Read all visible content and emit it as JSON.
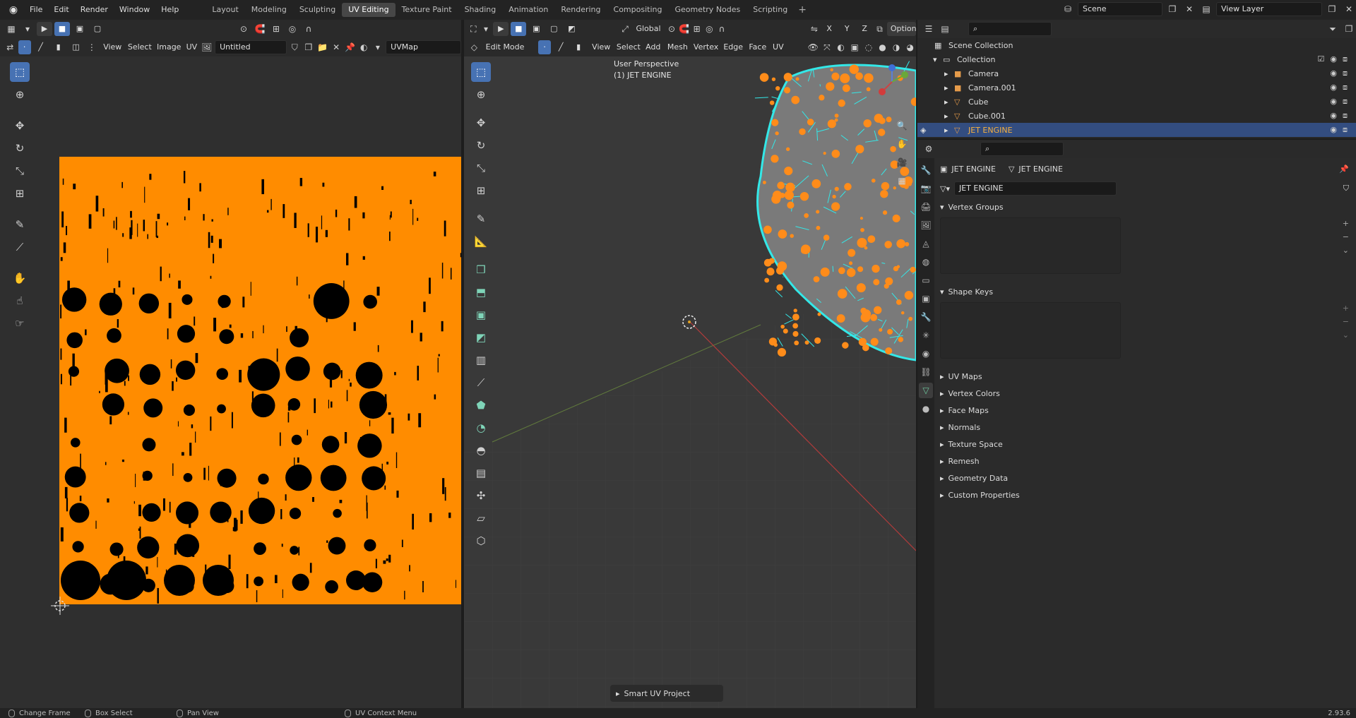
{
  "topbar": {
    "menus": [
      "File",
      "Edit",
      "Render",
      "Window",
      "Help"
    ],
    "workspaces": [
      "Layout",
      "Modeling",
      "Sculpting",
      "UV Editing",
      "Texture Paint",
      "Shading",
      "Animation",
      "Rendering",
      "Compositing",
      "Geometry Nodes",
      "Scripting"
    ],
    "active_workspace": "UV Editing",
    "scene": "Scene",
    "view_layer": "View Layer"
  },
  "uv_editor": {
    "menus": [
      "View",
      "Select",
      "Image",
      "UV"
    ],
    "image_name": "Untitled",
    "uv_map": "UVMap",
    "uv_fill_color": "#ff8c00",
    "island_color": "#000000"
  },
  "viewport": {
    "transform_orientation": "Global",
    "options_label": "Options",
    "mode": "Edit Mode",
    "menus": [
      "View",
      "Select",
      "Add",
      "Mesh",
      "Vertex",
      "Edge",
      "Face",
      "UV"
    ],
    "overlay_line1": "User Perspective",
    "overlay_line2": "(1) JET ENGINE",
    "redo_panel": "Smart UV Project",
    "axis_labels": {
      "x": "X",
      "y": "Y",
      "z": "Z"
    },
    "mesh_wire_color": "#33e8e8",
    "mesh_select_color": "#ff8c1a"
  },
  "outliner": {
    "root": "Scene Collection",
    "collection": "Collection",
    "items": [
      "Camera",
      "Camera.001",
      "Cube",
      "Cube.001",
      "JET ENGINE"
    ],
    "selected": "JET ENGINE"
  },
  "properties": {
    "breadcrumb_object": "JET ENGINE",
    "breadcrumb_data": "JET ENGINE",
    "data_name": "JET ENGINE",
    "open_sections": [
      "Vertex Groups",
      "Shape Keys"
    ],
    "closed_sections": [
      "UV Maps",
      "Vertex Colors",
      "Face Maps",
      "Normals",
      "Texture Space",
      "Remesh",
      "Geometry Data",
      "Custom Properties"
    ]
  },
  "statusbar": {
    "item1": "Change Frame",
    "item2": "Box Select",
    "item3": "Pan View",
    "item4": "UV Context Menu",
    "version": "2.93.6"
  }
}
